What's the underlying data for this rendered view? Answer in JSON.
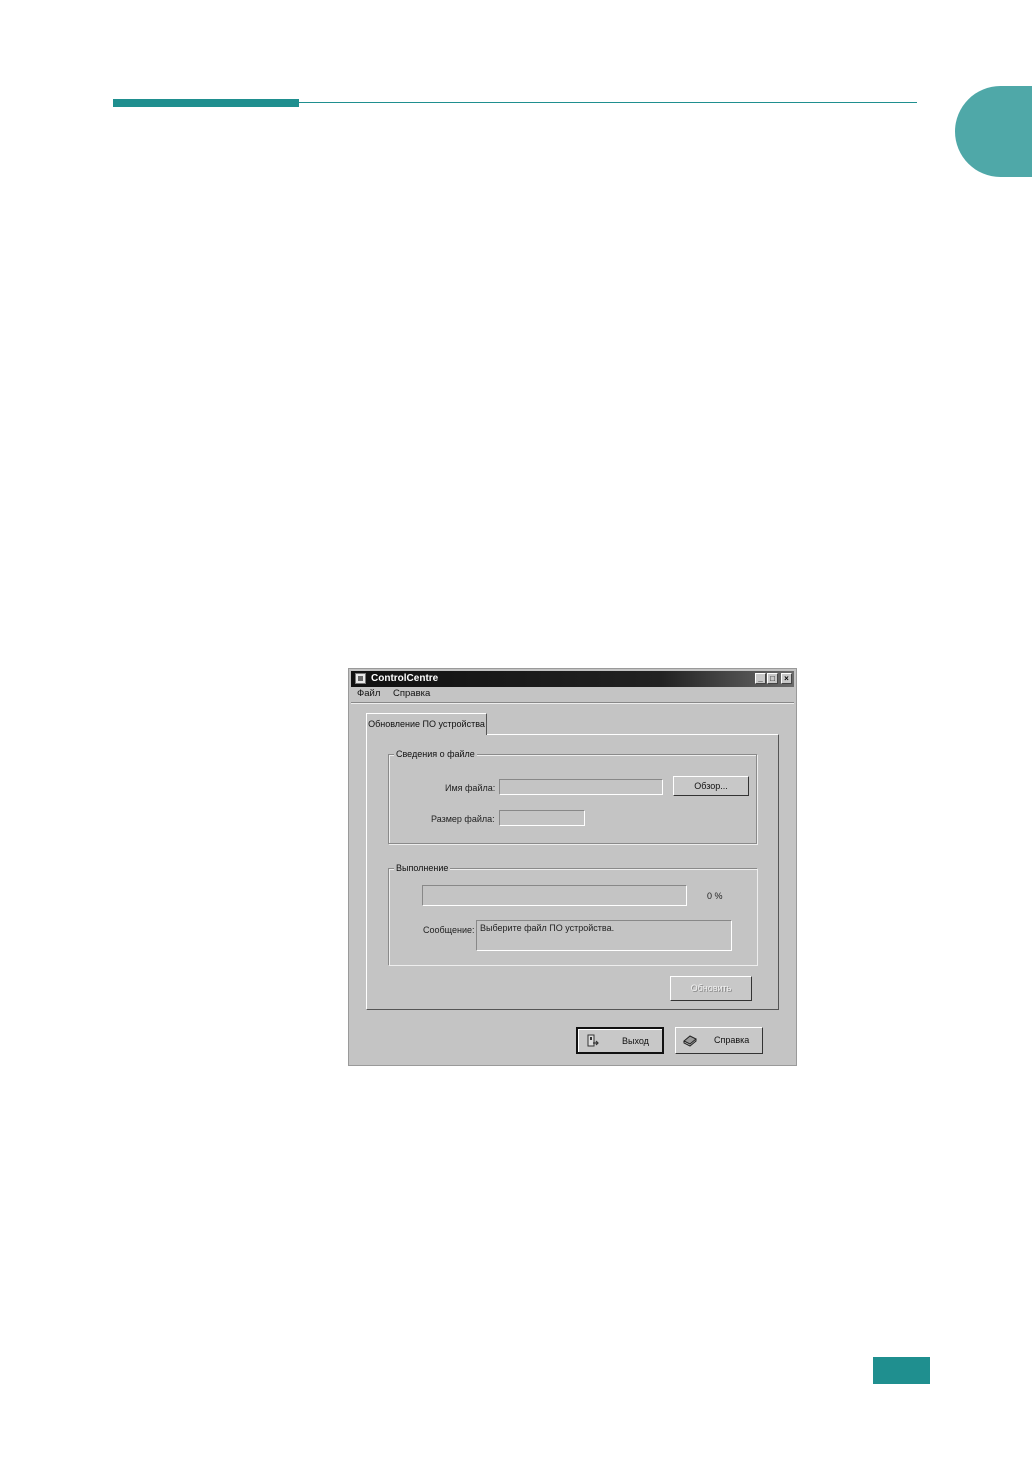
{
  "window": {
    "title": "ControlCentre",
    "minimize_glyph": "_",
    "maximize_glyph": "□",
    "close_glyph": "×"
  },
  "menu": [
    "Файл",
    "Справка"
  ],
  "tab": {
    "label": "Обновление ПО устройства"
  },
  "file_info": {
    "legend": "Сведения о файле",
    "filename_label": "Имя файла:",
    "filename_value": "",
    "browse_button": "Обзор...",
    "filesize_label": "Размер файла:",
    "filesize_value": ""
  },
  "progress": {
    "legend": "Выполнение",
    "percent_text": "0 %",
    "value": 0,
    "message_label": "Сообщение:",
    "message_text": "Выберите файл ПО устройства."
  },
  "buttons": {
    "update": "Обновить",
    "exit": "Выход",
    "help": "Справка"
  },
  "icons": [
    "app-icon",
    "exit-icon",
    "help-book-icon"
  ]
}
